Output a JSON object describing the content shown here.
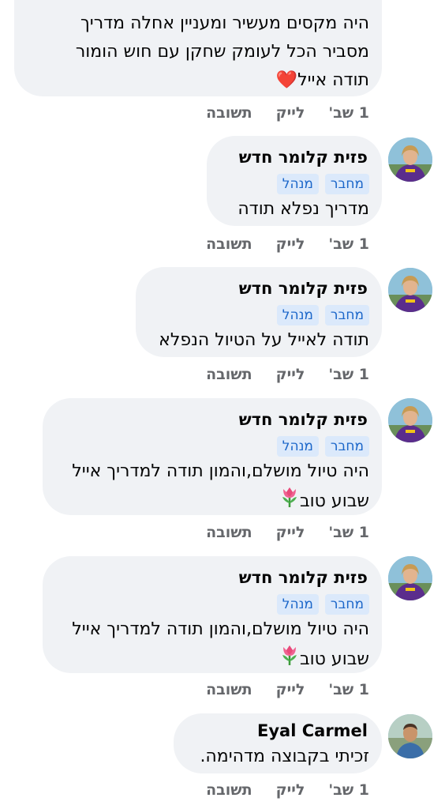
{
  "comments": [
    {
      "lines": [
        "היה מקסים מעשיר ומעניין אחלה מדריך",
        "מסביר הכל לעומק שחקן עם חוש הומור",
        "תודה אייל"
      ],
      "emoji": "❤️",
      "actions": {
        "time": "1 שב'",
        "like": "לייק",
        "reply": "תשובה"
      }
    },
    {
      "author": "פזית קלומר חדש",
      "badges": [
        "מחבר",
        "מנהל"
      ],
      "lines": [
        "מדריך נפלא תודה"
      ],
      "actions": {
        "time": "1 שב'",
        "like": "לייק",
        "reply": "תשובה"
      }
    },
    {
      "author": "פזית קלומר חדש",
      "badges": [
        "מחבר",
        "מנהל"
      ],
      "lines": [
        "תודה לאייל על הטיול הנפלא"
      ],
      "actions": {
        "time": "1 שב'",
        "like": "לייק",
        "reply": "תשובה"
      }
    },
    {
      "author": "פזית קלומר חדש",
      "badges": [
        "מחבר",
        "מנהל"
      ],
      "lines": [
        "היה טיול מושלם,והמון תודה למדריך אייל",
        "שבוע טוב"
      ],
      "emoji": "🌷",
      "actions": {
        "time": "1 שב'",
        "like": "לייק",
        "reply": "תשובה"
      }
    },
    {
      "author": "פזית קלומר חדש",
      "badges": [
        "מחבר",
        "מנהל"
      ],
      "lines": [
        "היה טיול מושלם,והמון תודה למדריך אייל",
        "שבוע טוב"
      ],
      "emoji": "🌷",
      "actions": {
        "time": "1 שב'",
        "like": "לייק",
        "reply": "תשובה"
      }
    },
    {
      "author": "Eyal Carmel",
      "lines": [
        "זכיתי בקבוצה מדהימה."
      ],
      "actions": {
        "time": "1 שב'",
        "like": "לייק",
        "reply": "תשובה"
      }
    }
  ],
  "colors": {
    "bubble": "#f0f2f5",
    "badge_bg": "#dbe9fb",
    "badge_text": "#1b66c9",
    "meta_text": "#65676b"
  }
}
